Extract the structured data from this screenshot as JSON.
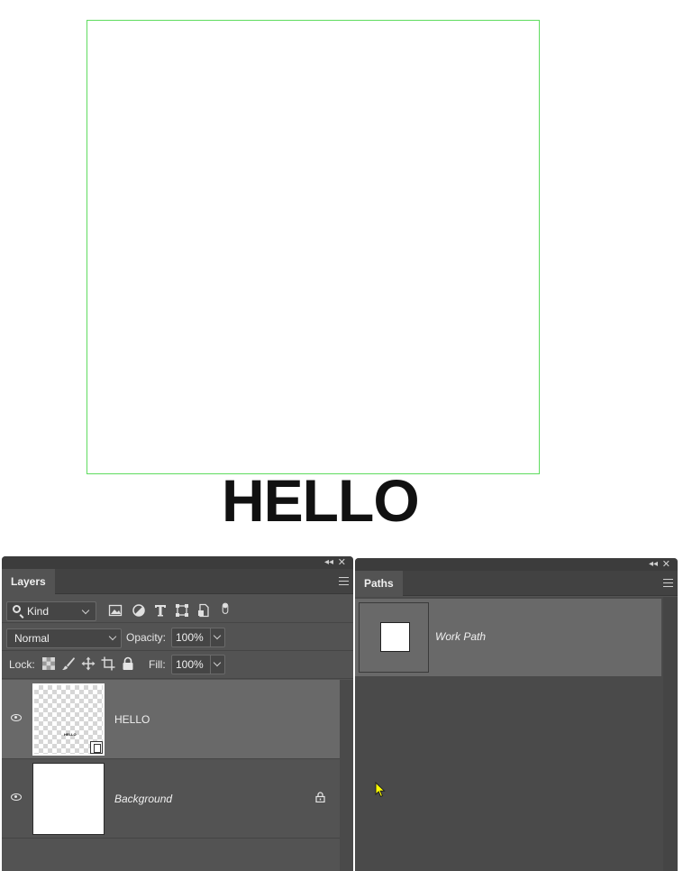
{
  "canvas": {
    "text": "HELLO",
    "guide_color": "#5fdc5f"
  },
  "layers_panel": {
    "tab_label": "Layers",
    "filter": {
      "kind_label": "Kind",
      "icons": [
        "image-filter-icon",
        "adjustment-filter-icon",
        "type-filter-icon",
        "shape-filter-icon",
        "smart-object-filter-icon",
        "filter-toggle-icon"
      ]
    },
    "blend_mode": "Normal",
    "opacity_label": "Opacity:",
    "opacity_value": "100%",
    "lock_label": "Lock:",
    "lock_icons": [
      "lock-transparent-pixels-icon",
      "lock-image-pixels-icon",
      "lock-position-icon",
      "lock-artboard-icon",
      "lock-all-icon"
    ],
    "fill_label": "Fill:",
    "fill_value": "100%",
    "layers": [
      {
        "name": "HELLO",
        "visible": true,
        "selected": true,
        "type": "smart-object",
        "thumb_text": "HELLO"
      },
      {
        "name": "Background",
        "visible": true,
        "selected": false,
        "locked": true
      }
    ]
  },
  "paths_panel": {
    "tab_label": "Paths",
    "paths": [
      {
        "name": "Work Path"
      }
    ]
  }
}
